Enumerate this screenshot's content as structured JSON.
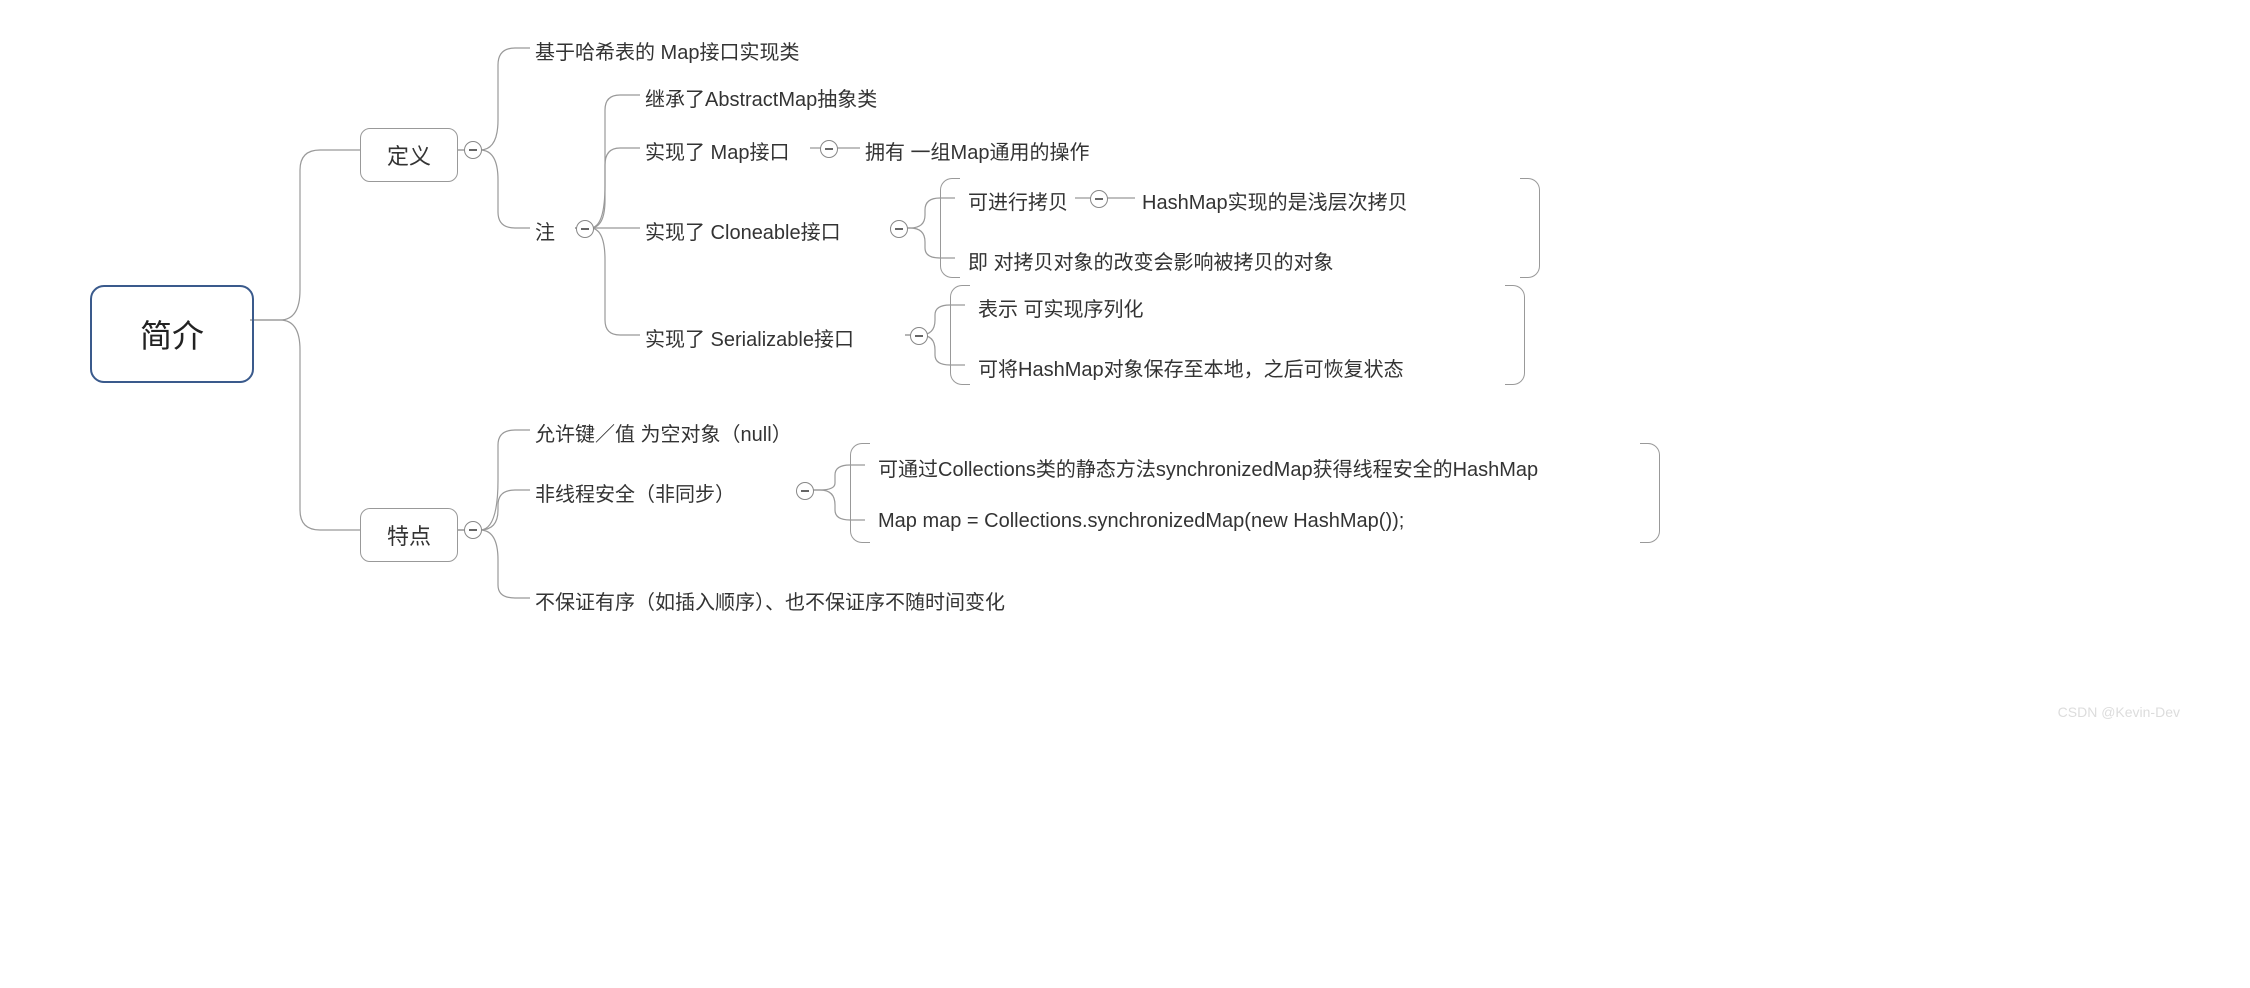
{
  "root": "简介",
  "definition": {
    "label": "定义",
    "items": [
      "基于哈希表的 Map接口实现类",
      {
        "label": "注",
        "items": [
          "继承了AbstractMap抽象类",
          {
            "label": "实现了 Map接口",
            "child": "拥有 一组Map通用的操作"
          },
          {
            "label": "实现了 Cloneable接口",
            "children": [
              {
                "label": "可进行拷贝",
                "child": "HashMap实现的是浅层次拷贝"
              },
              "即 对拷贝对象的改变会影响被拷贝的对象"
            ]
          },
          {
            "label": "实现了 Serializable接口",
            "children": [
              "表示 可实现序列化",
              "可将HashMap对象保存至本地，之后可恢复状态"
            ]
          }
        ]
      }
    ]
  },
  "features": {
    "label": "特点",
    "items": [
      "允许键／值 为空对象（null）",
      {
        "label": "非线程安全（非同步）",
        "children": [
          "可通过Collections类的静态方法synchronizedMap获得线程安全的HashMap",
          "Map map = Collections.synchronizedMap(new HashMap());"
        ]
      },
      "不保证有序（如插入顺序）、也不保证序不随时间变化"
    ]
  },
  "watermark": "CSDN @Kevin-Dev"
}
